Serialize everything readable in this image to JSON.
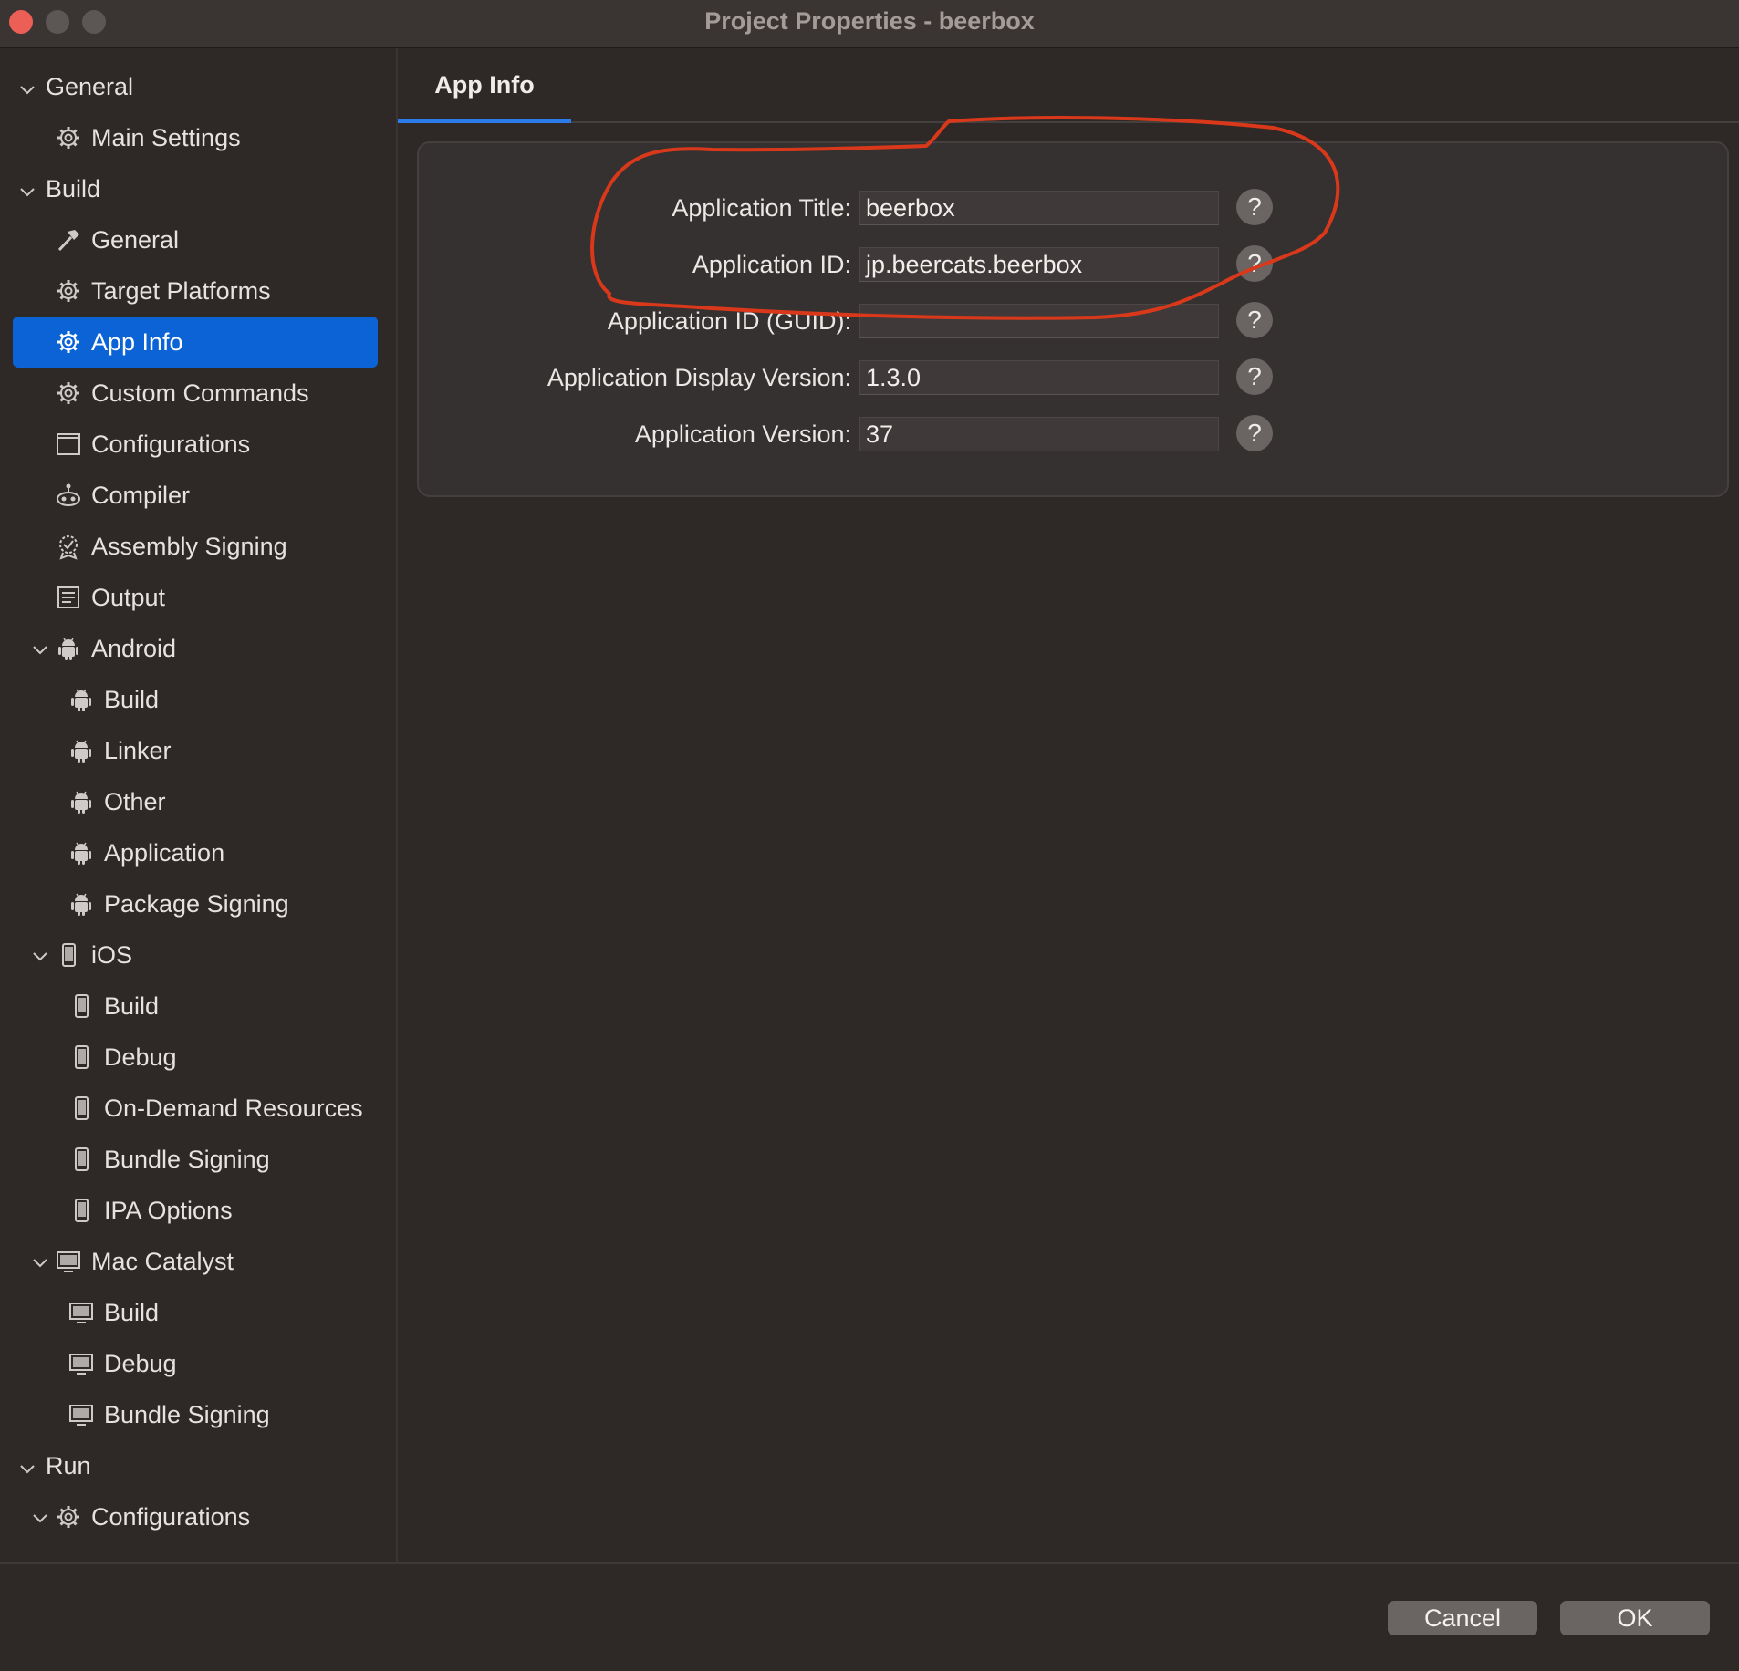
{
  "window": {
    "title": "Project Properties - beerbox"
  },
  "sidebar": {
    "items": [
      {
        "label": "General",
        "icon": "chevron-down-icon",
        "level": 0
      },
      {
        "label": "Main Settings",
        "icon": "gear-icon",
        "level": 1
      },
      {
        "label": "Build",
        "icon": "chevron-down-icon",
        "level": 0
      },
      {
        "label": "General",
        "icon": "hammer-icon",
        "level": 1
      },
      {
        "label": "Target Platforms",
        "icon": "gear-icon",
        "level": 1
      },
      {
        "label": "App Info",
        "icon": "gear-icon",
        "level": 1,
        "selected": true
      },
      {
        "label": "Custom Commands",
        "icon": "gear-icon",
        "level": 1
      },
      {
        "label": "Configurations",
        "icon": "window-icon",
        "level": 1
      },
      {
        "label": "Compiler",
        "icon": "compiler-icon",
        "level": 1
      },
      {
        "label": "Assembly Signing",
        "icon": "badge-icon",
        "level": 1
      },
      {
        "label": "Output",
        "icon": "output-icon",
        "level": 1
      },
      {
        "label": "Android",
        "icon": "android-icon",
        "level": 1,
        "expanded": true
      },
      {
        "label": "Build",
        "icon": "android-icon",
        "level": 2
      },
      {
        "label": "Linker",
        "icon": "android-icon",
        "level": 2
      },
      {
        "label": "Other",
        "icon": "android-icon",
        "level": 2
      },
      {
        "label": "Application",
        "icon": "android-icon",
        "level": 2
      },
      {
        "label": "Package Signing",
        "icon": "android-icon",
        "level": 2
      },
      {
        "label": "iOS",
        "icon": "phone-icon",
        "level": 1,
        "expanded": true
      },
      {
        "label": "Build",
        "icon": "phone-icon",
        "level": 2
      },
      {
        "label": "Debug",
        "icon": "phone-icon",
        "level": 2
      },
      {
        "label": "On-Demand Resources",
        "icon": "phone-icon",
        "level": 2
      },
      {
        "label": "Bundle Signing",
        "icon": "phone-icon",
        "level": 2
      },
      {
        "label": "IPA Options",
        "icon": "phone-icon",
        "level": 2
      },
      {
        "label": "Mac Catalyst",
        "icon": "monitor-icon",
        "level": 1,
        "expanded": true
      },
      {
        "label": "Build",
        "icon": "monitor-icon",
        "level": 2
      },
      {
        "label": "Debug",
        "icon": "monitor-icon",
        "level": 2
      },
      {
        "label": "Bundle Signing",
        "icon": "monitor-icon",
        "level": 2
      },
      {
        "label": "Run",
        "icon": "chevron-down-icon",
        "level": 0
      },
      {
        "label": "Configurations",
        "icon": "gear-icon",
        "level": 1,
        "expanded": true
      }
    ]
  },
  "tabs": [
    {
      "label": "App Info",
      "active": true
    }
  ],
  "form": {
    "fields": [
      {
        "label": "Application Title:",
        "value": "beerbox"
      },
      {
        "label": "Application ID:",
        "value": "jp.beercats.beerbox"
      },
      {
        "label": "Application ID (GUID):",
        "value": ""
      },
      {
        "label": "Application Display Version:",
        "value": "1.3.0"
      },
      {
        "label": "Application Version:",
        "value": "37"
      }
    ],
    "help_glyph": "?"
  },
  "buttons": {
    "cancel": "Cancel",
    "ok": "OK"
  },
  "colors": {
    "accent": "#0b63d6",
    "annotation": "#d9391a",
    "background": "#2e2826"
  }
}
